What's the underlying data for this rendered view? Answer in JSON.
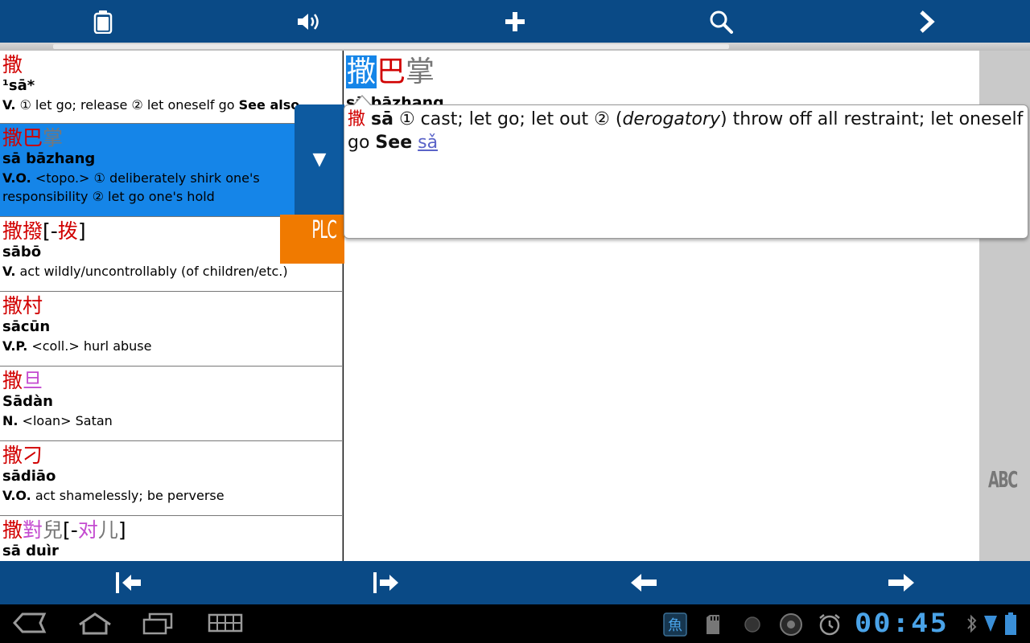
{
  "toolbar": {
    "icons": [
      "clipboard-icon",
      "speaker-icon",
      "plus-icon",
      "search-icon",
      "chevron-right-icon"
    ]
  },
  "list": {
    "entries": [
      {
        "hw": [
          {
            "t": "撒",
            "c": "red"
          }
        ],
        "py": "¹sā*",
        "pos": "V.",
        "def": " ① let go; release ② let oneself go  ",
        "see": "See also"
      },
      {
        "hw": [
          {
            "t": "撒巴",
            "c": "red"
          },
          {
            "t": "掌",
            "c": "gray"
          }
        ],
        "py": "sā bāzhang",
        "pos": "V.O.",
        "def": " <topo.> ① deliberately shirk one's responsibility ② let go one's hold"
      },
      {
        "hw": [
          {
            "t": "撒撥",
            "c": "red"
          },
          {
            "t": "[-",
            "c": "blk"
          },
          {
            "t": "拨",
            "c": "red"
          },
          {
            "t": "]",
            "c": "blk"
          }
        ],
        "py": "sābō",
        "pos": "V.",
        "def": " act wildly/uncontrollably (of children/etc.)"
      },
      {
        "hw": [
          {
            "t": "撒村",
            "c": "red"
          }
        ],
        "py": "sācūn",
        "pos": "V.P.",
        "def": " <coll.> hurl abuse"
      },
      {
        "hw": [
          {
            "t": "撒",
            "c": "red"
          },
          {
            "t": "旦",
            "c": "mag"
          }
        ],
        "py": "Sādàn",
        "pos": "N.",
        "def": " <loan> Satan"
      },
      {
        "hw": [
          {
            "t": "撒刁",
            "c": "red"
          }
        ],
        "py": "sādiāo",
        "pos": "V.O.",
        "def": " act shamelessly; be perverse"
      },
      {
        "hw": [
          {
            "t": "撒",
            "c": "red"
          },
          {
            "t": "對",
            "c": "mag"
          },
          {
            "t": "兒",
            "c": "gray"
          },
          {
            "t": "[-",
            "c": "blk"
          },
          {
            "t": "对",
            "c": "mag"
          },
          {
            "t": "儿",
            "c": "gray"
          },
          {
            "t": "]",
            "c": "blk"
          }
        ],
        "py": "sā duìr",
        "pos": "",
        "def": ""
      }
    ]
  },
  "detail": {
    "hw_hl": "撒",
    "hw_red": "巴",
    "hw_gray": "掌",
    "py": "sā bāzhang"
  },
  "popup": {
    "hw": "撒",
    "py": "sā",
    "def1": " ① cast; let go; let out ② (",
    "italic": "derogatory",
    "def2": ") throw off all restraint; let oneself go  ",
    "see": "See",
    "link": "sǎ",
    "tab_glyph": "▼",
    "plc": "PLC"
  },
  "side": {
    "abc": "ABC"
  },
  "bottom": {
    "icons": [
      "first-page-icon",
      "last-page-icon",
      "arrow-left-icon",
      "arrow-right-icon"
    ]
  },
  "system": {
    "clock": "00:45",
    "accent": "#4aa3e8"
  },
  "colors": {
    "toolbar": "#0a4a86",
    "selected": "#1585e8",
    "headword_red": "#d10000",
    "plc_orange": "#f07a00"
  }
}
